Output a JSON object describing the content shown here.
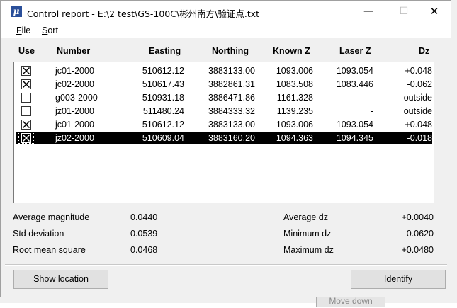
{
  "window": {
    "title": "Control report - E:\\2 test\\GS-100C\\彬州南方\\验证点.txt",
    "app_icon_glyph": "μ"
  },
  "window_controls": {
    "minimize": "—",
    "maximize": "☐",
    "close": "✕"
  },
  "menu": {
    "file": {
      "key": "F",
      "rest": "ile"
    },
    "sort": {
      "key": "S",
      "rest": "ort"
    }
  },
  "columns": {
    "use": "Use",
    "number": "Number",
    "easting": "Easting",
    "northing": "Northing",
    "known_z": "Known Z",
    "laser_z": "Laser Z",
    "dz": "Dz"
  },
  "rows": [
    {
      "checked": true,
      "number": "jc01-2000",
      "easting": "510612.12",
      "northing": "3883133.00",
      "known_z": "1093.006",
      "laser_z": "1093.054",
      "dz": "+0.048",
      "selected": false
    },
    {
      "checked": true,
      "number": "jc02-2000",
      "easting": "510617.43",
      "northing": "3882861.31",
      "known_z": "1083.508",
      "laser_z": "1083.446",
      "dz": "-0.062",
      "selected": false
    },
    {
      "checked": false,
      "number": "g003-2000",
      "easting": "510931.18",
      "northing": "3886471.86",
      "known_z": "1161.328",
      "laser_z": "-",
      "dz": "outside",
      "selected": false
    },
    {
      "checked": false,
      "number": "jz01-2000",
      "easting": "511480.24",
      "northing": "3884333.32",
      "known_z": "1139.235",
      "laser_z": "-",
      "dz": "outside",
      "selected": false
    },
    {
      "checked": true,
      "number": "jc01-2000",
      "easting": "510612.12",
      "northing": "3883133.00",
      "known_z": "1093.006",
      "laser_z": "1093.054",
      "dz": "+0.048",
      "selected": false
    },
    {
      "checked": true,
      "number": "jz02-2000",
      "easting": "510609.04",
      "northing": "3883160.20",
      "known_z": "1094.363",
      "laser_z": "1094.345",
      "dz": "-0.018",
      "selected": true
    }
  ],
  "stats": {
    "average_magnitude": {
      "label": "Average magnitude",
      "value": "0.0440"
    },
    "std_deviation": {
      "label": "Std deviation",
      "value": "0.0539"
    },
    "rms": {
      "label": "Root mean square",
      "value": "0.0468"
    },
    "average_dz": {
      "label": "Average dz",
      "value": "+0.0040"
    },
    "minimum_dz": {
      "label": "Minimum dz",
      "value": "-0.0620"
    },
    "maximum_dz": {
      "label": "Maximum dz",
      "value": "+0.0480"
    }
  },
  "buttons": {
    "show_location": {
      "key": "S",
      "rest": "how location"
    },
    "identify": {
      "key": "I",
      "rest": "dentify"
    }
  },
  "background": {
    "move_down": "Move down"
  },
  "colors": {
    "selection": "#000000",
    "window_bg": "#f0f0f0",
    "app_icon": "#2a4f9a"
  }
}
